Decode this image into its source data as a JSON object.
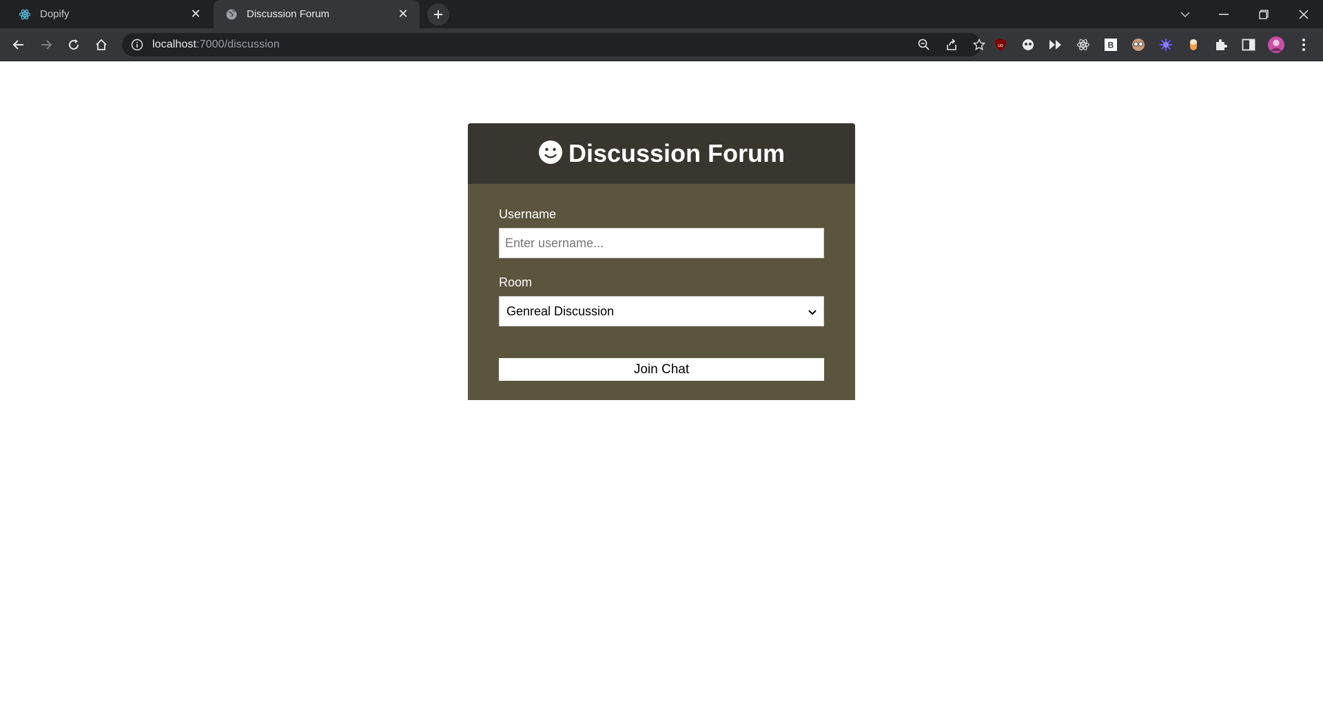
{
  "browser": {
    "tabs": [
      {
        "label": "Dopify",
        "icon": "react-icon",
        "active": false
      },
      {
        "label": "Discussion Forum",
        "icon": "globe-icon",
        "active": true
      }
    ],
    "url_host": "localhost",
    "url_rest": ":7000/discussion"
  },
  "page": {
    "header": {
      "icon": "smile-icon",
      "title": "Discussion Forum"
    },
    "username": {
      "label": "Username",
      "placeholder": "Enter username...",
      "value": ""
    },
    "room": {
      "label": "Room",
      "selected": "Genreal Discussion"
    },
    "join_button": "Join Chat"
  },
  "colors": {
    "header_bg": "#38362f",
    "card_bg": "#5c553e"
  }
}
